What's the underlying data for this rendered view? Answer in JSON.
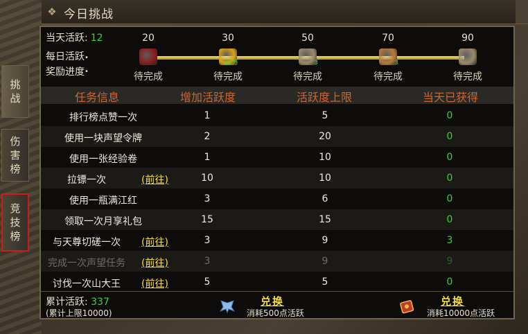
{
  "window": {
    "title": "今日挑战"
  },
  "side_tabs": [
    {
      "label_lines": [
        "挑",
        "战"
      ]
    },
    {
      "label_lines": [
        "伤",
        "害",
        "榜"
      ]
    },
    {
      "label_lines": [
        "竞",
        "技",
        "榜"
      ]
    }
  ],
  "activity": {
    "label": "当天活跃:",
    "value": "12"
  },
  "reward": {
    "label_line1": "每日活跃",
    "label_line2": "奖励进度",
    "dot": "•"
  },
  "milestones": [
    {
      "threshold": "20",
      "status": "待完成",
      "icon": "money-bag-icon",
      "color": "#8a1d1d",
      "badge": ""
    },
    {
      "threshold": "30",
      "status": "待完成",
      "icon": "gold-coins-icon",
      "color": "#d9a21c",
      "badge": "12万"
    },
    {
      "threshold": "50",
      "status": "待完成",
      "icon": "item-pack-icon",
      "color": "#9a8a6a",
      "badge": "3"
    },
    {
      "threshold": "70",
      "status": "待完成",
      "icon": "scroll-pack-icon",
      "color": "#b97a3a",
      "badge": "3"
    },
    {
      "threshold": "90",
      "status": "待完成",
      "icon": "item-pack-icon",
      "color": "#9a8a6a",
      "badge": ""
    }
  ],
  "table": {
    "headers": [
      "任务信息",
      "增加活跃度",
      "活跃度上限",
      "当天已获得"
    ],
    "rows": [
      {
        "name": "排行榜点赞一次",
        "go": "",
        "add": "1",
        "limit": "5",
        "got": "0"
      },
      {
        "name": "使用一块声望令牌",
        "go": "",
        "add": "2",
        "limit": "20",
        "got": "0"
      },
      {
        "name": "使用一张经验卷",
        "go": "",
        "add": "1",
        "limit": "10",
        "got": "0"
      },
      {
        "name": "拉镖一次",
        "go": "(前往)",
        "add": "10",
        "limit": "10",
        "got": "0"
      },
      {
        "name": "使用一瓶满江红",
        "go": "",
        "add": "3",
        "limit": "6",
        "got": "0"
      },
      {
        "name": "领取一次月享礼包",
        "go": "",
        "add": "15",
        "limit": "15",
        "got": "0"
      },
      {
        "name": "与天尊切磋一次",
        "go": "(前往)",
        "add": "3",
        "limit": "9",
        "got": "3"
      },
      {
        "name": "完成一次声望任务",
        "go": "(前往)",
        "add": "3",
        "limit": "9",
        "got": "9"
      },
      {
        "name": "讨伐一次山大王",
        "go": "(前往)",
        "add": "5",
        "limit": "5",
        "got": "0"
      }
    ]
  },
  "footer": {
    "total_label": "累计活跃:",
    "total_value": "337",
    "cap_text": "(累计上限10000)",
    "exchange": [
      {
        "label": "兑换",
        "cost": "消耗500点活跃",
        "icon": "blue-wings-icon"
      },
      {
        "label": "兑换",
        "cost": "消耗10000点活跃",
        "icon": "red-book-icon"
      }
    ]
  }
}
